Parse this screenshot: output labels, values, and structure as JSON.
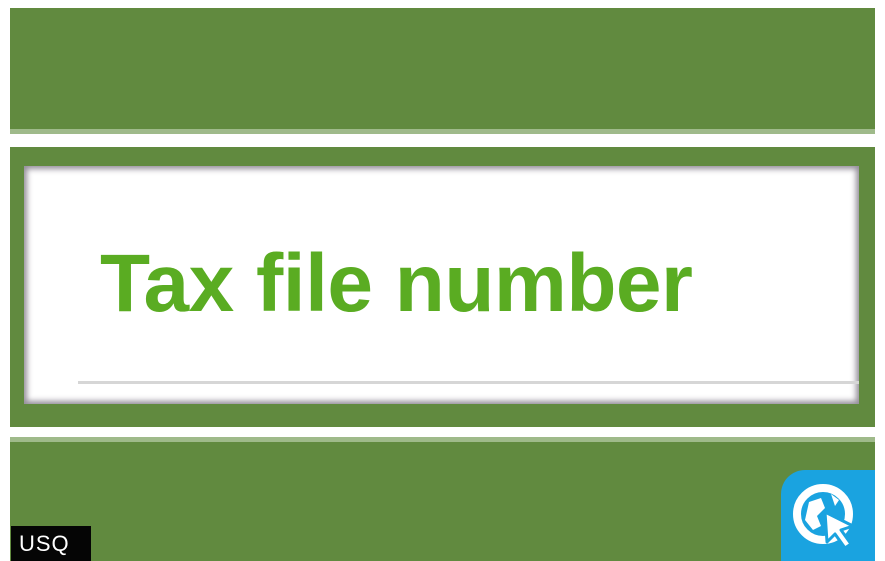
{
  "field": {
    "label": "Tax file number",
    "label_color": "#5aac22"
  },
  "frame": {
    "band_color": "#618a3f",
    "stripe_color": "#9fba8a"
  },
  "badge": {
    "text": "USQ"
  },
  "corner_icon": {
    "icon": "web-globe-cursor-icon",
    "color": "#1aa3e0"
  }
}
